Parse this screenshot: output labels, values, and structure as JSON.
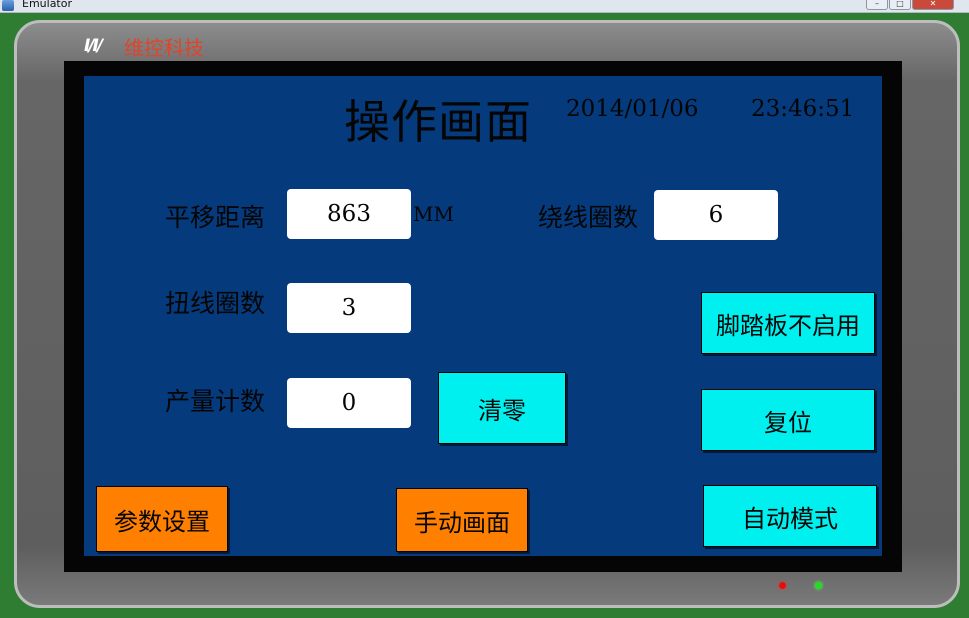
{
  "window": {
    "title": "Emulator",
    "controls": [
      "–",
      "□",
      "✕"
    ]
  },
  "device": {
    "brand_logo": "I/I/",
    "brand_name": "维控科技"
  },
  "screen": {
    "title": "操作画面",
    "date": "2014/01/06",
    "time": "23:46:51",
    "fields": {
      "translate_distance": {
        "label": "平移距离",
        "value": "863",
        "unit": "MM"
      },
      "winding_turns": {
        "label": "绕线圈数",
        "value": "6"
      },
      "twist_turns": {
        "label": "扭线圈数",
        "value": "3"
      },
      "production_count": {
        "label": "产量计数",
        "value": "0"
      }
    },
    "buttons": {
      "clear": "清零",
      "foot_pedal": "脚踏板不启用",
      "reset": "复位",
      "params": "参数设置",
      "manual": "手动画面",
      "auto_mode": "自动模式"
    },
    "colors": {
      "background": "#053a7c",
      "cyan_button": "#00f0f0",
      "orange_button": "#ff7f00"
    }
  },
  "indicators": {
    "red_led": "red-led-icon",
    "green_led": "green-led-icon"
  }
}
